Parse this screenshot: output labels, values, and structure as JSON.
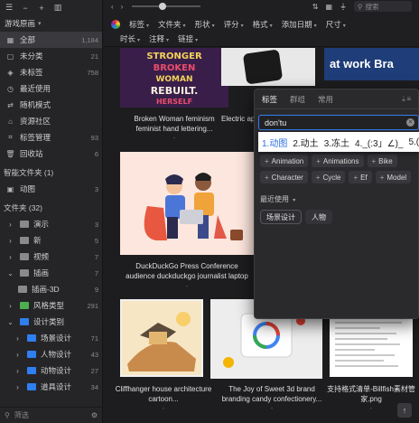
{
  "sidebar": {
    "library_name": "游戏原画",
    "items": [
      {
        "label": "全部",
        "count": "1,184",
        "icon": "grid-icon"
      },
      {
        "label": "未分类",
        "count": "21",
        "icon": "unsorted-icon"
      },
      {
        "label": "未标签",
        "count": "758",
        "icon": "untagged-icon"
      },
      {
        "label": "最近使用",
        "count": "",
        "icon": "clock-icon"
      },
      {
        "label": "随机模式",
        "count": "",
        "icon": "shuffle-icon"
      },
      {
        "label": "资源社区",
        "count": "",
        "icon": "community-icon"
      },
      {
        "label": "标签管理",
        "count": "93",
        "icon": "tag-icon"
      },
      {
        "label": "回收站",
        "count": "6",
        "icon": "trash-icon"
      }
    ],
    "smart_folders_header": "智能文件夹 (1)",
    "smart_folders": [
      {
        "label": "动图",
        "count": "3"
      }
    ],
    "folders_header": "文件夹 (32)",
    "folders": [
      {
        "label": "演示",
        "count": "3",
        "color": "#8a8a8a"
      },
      {
        "label": "新",
        "count": "5",
        "color": "#8a8a8a"
      },
      {
        "label": "视频",
        "count": "7",
        "color": "#8a8a8a"
      },
      {
        "label": "插画",
        "count": "7",
        "color": "#8a8a8a"
      },
      {
        "label": "插画-3D",
        "count": "9",
        "color": "#8a8a8a"
      },
      {
        "label": "风格类型",
        "count": "291",
        "color": "#4caf50"
      },
      {
        "label": "设计类别",
        "count": "",
        "color": "#2f7ff0"
      },
      {
        "label": "场景设计",
        "count": "71",
        "color": "#2f7ff0"
      },
      {
        "label": "人物设计",
        "count": "43",
        "color": "#2f7ff0"
      },
      {
        "label": "动物设计",
        "count": "27",
        "color": "#2f7ff0"
      },
      {
        "label": "道具设计",
        "count": "34",
        "color": "#2f7ff0"
      }
    ],
    "filter_placeholder": "筛选"
  },
  "toolbar": {
    "search_placeholder": "搜索",
    "filters_row1": [
      "标签",
      "文件夹",
      "形状",
      "评分",
      "格式",
      "添加日期",
      "尺寸"
    ],
    "filters_row2": [
      "时长",
      "注释",
      "链接"
    ]
  },
  "grid": {
    "items": [
      {
        "caption": "Broken Woman feminism feminist hand lettering...",
        "sub": "-"
      },
      {
        "caption": "Electric app app",
        "sub": "-"
      },
      {
        "caption": "DuckDuckGo Press Conference audience duckduckgo journalist laptop",
        "sub": "-"
      },
      {
        "caption": "Cliffhanger house architecture cartoon...",
        "sub": "-"
      },
      {
        "caption": "The Joy of Sweet 3d brand branding candy confectionery...",
        "sub": "-"
      },
      {
        "caption": "支持格式清单-Billfish素材管家.png",
        "sub": "-"
      }
    ],
    "poster_text": [
      "STRONGER",
      "BROKEN",
      "WOMAN",
      "REBUILT.",
      "HERSELF"
    ],
    "work_text": "at work Bra"
  },
  "tag_popup": {
    "tabs": [
      "标签",
      "群组",
      "常用"
    ],
    "input_value": "don'tu",
    "suggestions": [
      "Animation",
      "Animations",
      "Bike",
      "Character",
      "Cycle",
      "Ef",
      "Model"
    ],
    "recent_label": "最近使用",
    "recent_tags": [
      "场景设计",
      "人物"
    ]
  },
  "ime": {
    "candidates": [
      "1.动图",
      "2.动土",
      "3.冻土",
      "4._(:3」∠)_",
      "5.("
    ]
  }
}
